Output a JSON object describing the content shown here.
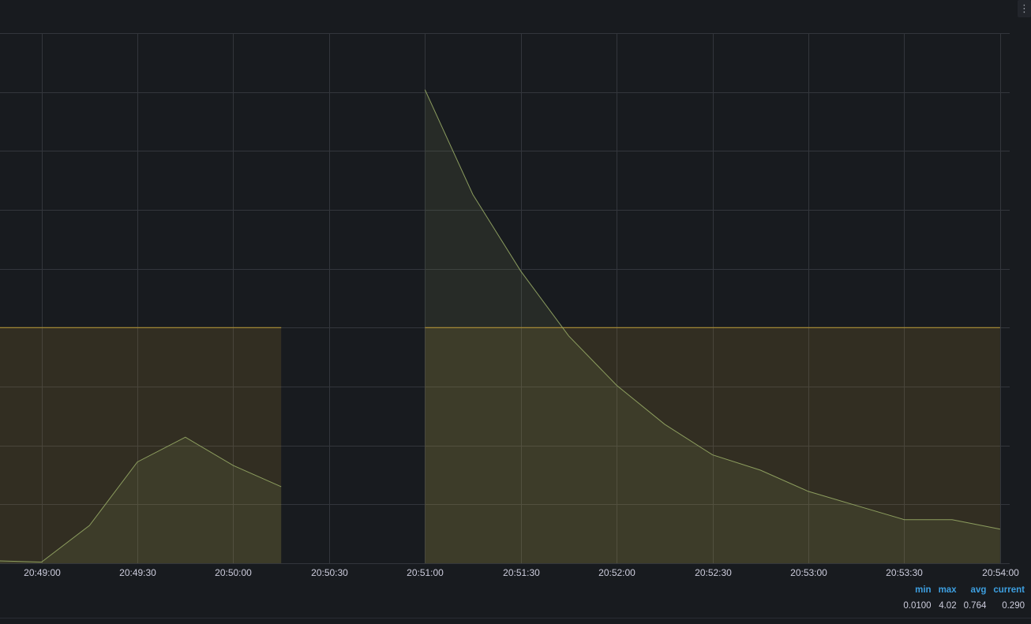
{
  "chart_data": {
    "type": "area",
    "title": "",
    "xlabel": "",
    "ylabel": "",
    "x_ticks": [
      "20:49:00",
      "20:49:30",
      "20:50:00",
      "20:50:30",
      "20:51:00",
      "20:51:30",
      "20:52:00",
      "20:52:30",
      "20:53:00",
      "20:53:30",
      "20:54:00"
    ],
    "xlim": [
      "20:48:47",
      "20:54:03"
    ],
    "ylim": [
      0,
      4.5
    ],
    "grid": true,
    "series": [
      {
        "color": "#96a865",
        "points": [
          [
            "20:48:45",
            0.02
          ],
          [
            "20:49:00",
            0.01
          ],
          [
            "20:49:15",
            0.32
          ],
          [
            "20:49:30",
            0.86
          ],
          [
            "20:49:45",
            1.07
          ],
          [
            "20:50:00",
            0.83
          ],
          [
            "20:50:15",
            0.65
          ],
          null,
          [
            "20:51:00",
            4.02
          ],
          [
            "20:51:15",
            3.13
          ],
          [
            "20:51:30",
            2.48
          ],
          [
            "20:51:45",
            1.93
          ],
          [
            "20:52:00",
            1.51
          ],
          [
            "20:52:15",
            1.18
          ],
          [
            "20:52:30",
            0.92
          ],
          [
            "20:52:45",
            0.79
          ],
          [
            "20:53:00",
            0.61
          ],
          [
            "20:53:15",
            0.49
          ],
          [
            "20:53:30",
            0.37
          ],
          [
            "20:53:45",
            0.37
          ],
          [
            "20:54:00",
            0.29
          ]
        ]
      },
      {
        "color": "#c9a435",
        "points": [
          [
            "20:48:45",
            2
          ],
          [
            "20:50:15",
            2
          ],
          null,
          [
            "20:51:00",
            2
          ],
          [
            "20:54:00",
            2
          ]
        ]
      }
    ]
  },
  "legend": {
    "headers": {
      "min": "min",
      "max": "max",
      "avg": "avg",
      "current": "current"
    },
    "values": {
      "min": "0.0100",
      "max": "4.02",
      "avg": "0.764",
      "current": "0.290"
    }
  },
  "colors": {
    "background": "#181b1f",
    "grid": "#33363c",
    "legend_header": "#3d9fe0"
  },
  "icons": {
    "panel_menu": "vertical-ellipsis-icon"
  },
  "menu_glyph": "⋮"
}
